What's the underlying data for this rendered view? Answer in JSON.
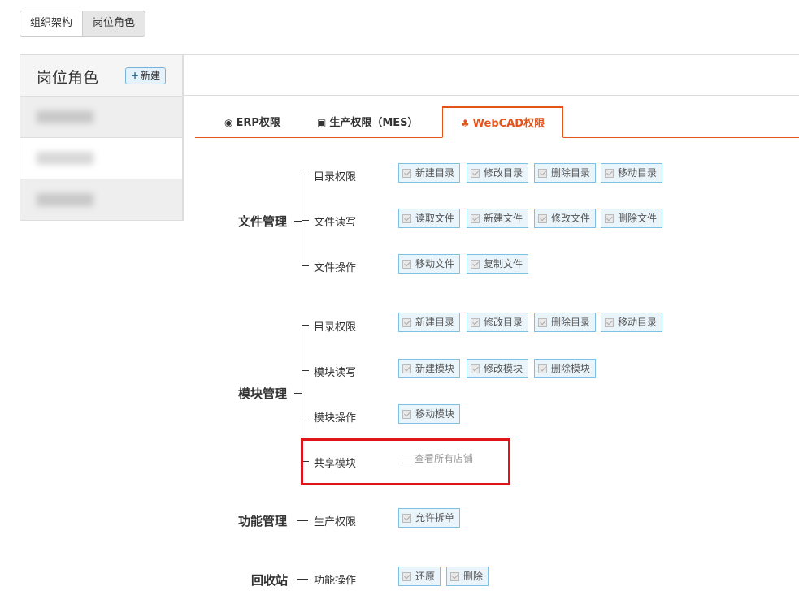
{
  "top_tabs": [
    "组织架构",
    "岗位角色"
  ],
  "sidebar": {
    "title": "岗位角色",
    "new_button": "新建"
  },
  "perm_tabs": [
    {
      "label": "ERP权限",
      "icon": "globe-icon"
    },
    {
      "label": "生产权限（MES）",
      "icon": "money-icon"
    },
    {
      "label": "WebCAD权限",
      "icon": "sitemap-icon"
    }
  ],
  "groups": {
    "file": {
      "title": "文件管理",
      "rows": [
        {
          "label": "目录权限",
          "items": [
            "新建目录",
            "修改目录",
            "删除目录",
            "移动目录"
          ]
        },
        {
          "label": "文件读写",
          "items": [
            "读取文件",
            "新建文件",
            "修改文件",
            "删除文件"
          ]
        },
        {
          "label": "文件操作",
          "items": [
            "移动文件",
            "复制文件"
          ]
        }
      ]
    },
    "module": {
      "title": "模块管理",
      "rows": [
        {
          "label": "目录权限",
          "items": [
            "新建目录",
            "修改目录",
            "删除目录",
            "移动目录"
          ]
        },
        {
          "label": "模块读写",
          "items": [
            "新建模块",
            "修改模块",
            "删除模块"
          ]
        },
        {
          "label": "模块操作",
          "items": [
            "移动模块"
          ]
        },
        {
          "label": "共享模块",
          "items": [
            "查看所有店铺"
          ]
        }
      ]
    },
    "function": {
      "title": "功能管理",
      "rows": [
        {
          "label": "生产权限",
          "items": [
            "允许拆单"
          ]
        }
      ]
    },
    "recycle": {
      "title": "回收站",
      "rows": [
        {
          "label": "功能操作",
          "items": [
            "还原",
            "删除"
          ]
        }
      ]
    }
  },
  "colors": {
    "accent": "#e5531a",
    "highlight": "#e0151b",
    "checkbox_border": "#7fc1e3"
  }
}
